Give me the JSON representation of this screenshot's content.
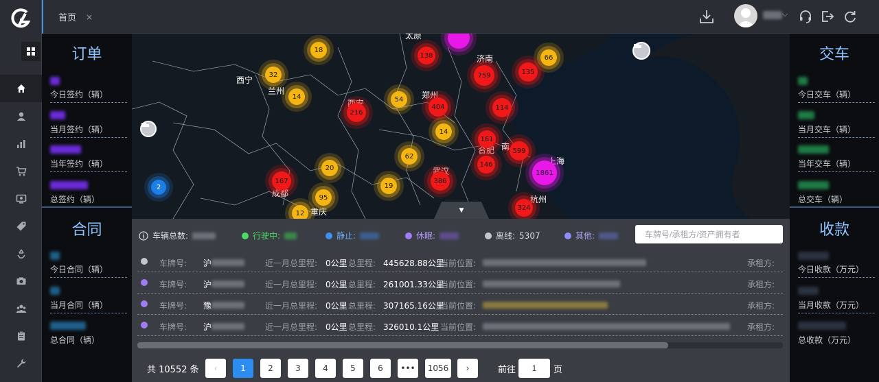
{
  "nav": {
    "items": [
      {
        "name": "home-icon",
        "active": true
      },
      {
        "name": "user-icon"
      },
      {
        "name": "bar-chart-icon"
      },
      {
        "name": "cart-icon"
      },
      {
        "name": "monitor-icon"
      },
      {
        "name": "tag-icon"
      },
      {
        "name": "recycle-icon"
      },
      {
        "name": "camera-icon"
      },
      {
        "name": "group-icon"
      },
      {
        "name": "clipboard-icon"
      },
      {
        "name": "wrench-icon"
      }
    ]
  },
  "topbar": {
    "tab_label": "首页",
    "tab_close": "×"
  },
  "left_panel": {
    "orders": {
      "title": "订单",
      "stats": [
        {
          "label": "今日签约（辆）"
        },
        {
          "label": "当月签约（辆）"
        },
        {
          "label": "当年签约（辆）"
        },
        {
          "label": "总签约（辆）"
        }
      ]
    },
    "contracts": {
      "title": "合同",
      "stats": [
        {
          "label": "今日合同（辆）"
        },
        {
          "label": "当月合同（辆）"
        },
        {
          "label": "总合同（辆）"
        }
      ]
    }
  },
  "right_panel": {
    "delivery": {
      "title": "交车",
      "stats": [
        {
          "label": "今日交车（辆）"
        },
        {
          "label": "当月交车（辆）"
        },
        {
          "label": "当年交车（辆）"
        },
        {
          "label": "总交车（辆）"
        }
      ]
    },
    "payments": {
      "title": "收款",
      "stats": [
        {
          "label": "今日收款（万元）"
        },
        {
          "label": "当月收款（万元）"
        },
        {
          "label": "总收款（万元）"
        }
      ]
    }
  },
  "map": {
    "cities": [
      "太原",
      "济南",
      "西宁",
      "兰州",
      "郑州",
      "西安",
      "南",
      "上海",
      "合肥",
      "武汉",
      "成都",
      "重庆",
      "杭州"
    ],
    "clusters": [
      "18",
      "138",
      "66",
      "759",
      "135",
      "32",
      "14",
      "54",
      "404",
      "114",
      "216",
      "14",
      "161",
      "599",
      "62",
      "146",
      "1861",
      "20",
      "167",
      "19",
      "386",
      "2",
      "95",
      "324",
      "12"
    ]
  },
  "status": {
    "total_label": "车辆总数:",
    "driving_label": "行驶中:",
    "idle_label": "静止:",
    "sleep_label": "休眠:",
    "offline_label": "离线:",
    "offline_value": "5307",
    "other_label": "其他:",
    "colors": {
      "driving": "#4cd964",
      "idle": "#3f8ef0",
      "sleep": "#a07cf6",
      "offline": "#c4c8ce",
      "other": "#8f8cf5"
    }
  },
  "search": {
    "placeholder": "车牌号/承租方/资产拥有者"
  },
  "list": {
    "plate_label": "车牌号:",
    "month_mileage_label": "近一月总里程:",
    "total_mileage_label": "总里程:",
    "location_label": "当前位置:",
    "lessee_label": "承租方:",
    "rows": [
      {
        "dot": "#c4c8ce",
        "plate_prefix": "沪",
        "month_mileage": "0公里",
        "total_mileage": "445628.88公里"
      },
      {
        "dot": "#a07cf6",
        "plate_prefix": "沪",
        "month_mileage": "0公里",
        "total_mileage": "261001.33公里"
      },
      {
        "dot": "#a07cf6",
        "plate_prefix": "豫",
        "month_mileage": "0公里",
        "total_mileage": "307165.16公里"
      },
      {
        "dot": "#a07cf6",
        "plate_prefix": "沪",
        "month_mileage": "0公里",
        "total_mileage": "326010.1公里"
      }
    ]
  },
  "pager": {
    "total": "共 10552 条",
    "pages": [
      "1",
      "2",
      "3",
      "4",
      "5",
      "6",
      "•••",
      "1056"
    ],
    "goto_label": "前往",
    "goto_value": "1",
    "page_suffix": "页"
  }
}
